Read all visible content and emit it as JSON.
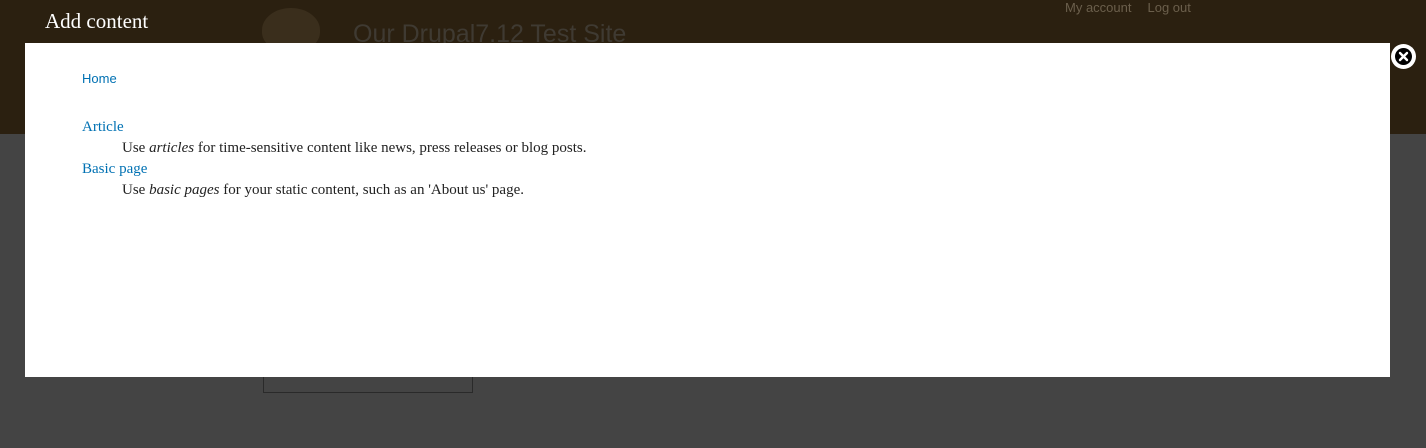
{
  "site": {
    "name": "Our Drupal7.12 Test Site",
    "secondary_menu": [
      "My account",
      "Log out"
    ]
  },
  "overlay": {
    "title": "Add content",
    "close_icon": "close-icon"
  },
  "breadcrumb": {
    "home": "Home"
  },
  "content_types": [
    {
      "label": "Article",
      "desc_before": "Use ",
      "desc_em": "articles",
      "desc_after": " for time-sensitive content like news, press releases or blog posts."
    },
    {
      "label": "Basic page",
      "desc_before": "Use ",
      "desc_em": "basic pages",
      "desc_after": " for your static content, such as an 'About us' page."
    }
  ],
  "colors": {
    "link": "#0071b3",
    "header_bg": "#2b2010",
    "overlay_bg": "#444444"
  }
}
